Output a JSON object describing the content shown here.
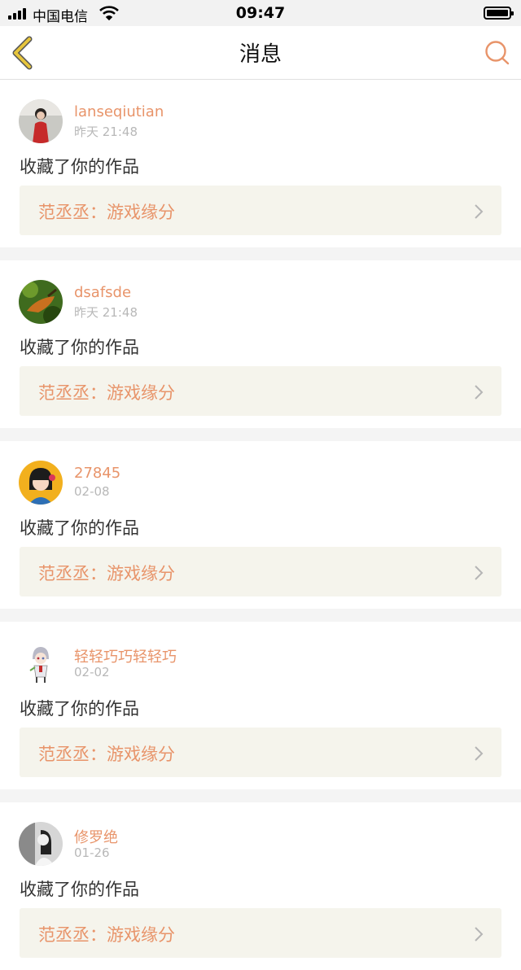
{
  "status_bar": {
    "carrier": "中国电信",
    "time": "09:47",
    "icons": [
      "signal-icon",
      "wifi-icon",
      "battery-icon"
    ]
  },
  "header": {
    "title": "消息",
    "back_icon": "chevron-left-icon",
    "search_icon": "search-icon"
  },
  "colors": {
    "accent": "#e8946a",
    "back_icon": "#e6c53d",
    "card_link_bg": "#f5f4ec",
    "separator": "#f4f4f4"
  },
  "messages": [
    {
      "username": "lanseqiutian",
      "time": "昨天 21:48",
      "action": "收藏了你的作品",
      "work_title": "范丞丞：游戏缘分",
      "avatar": "avatar-girl-red-dress"
    },
    {
      "username": "dsafsde",
      "time": "昨天 21:48",
      "action": "收藏了你的作品",
      "work_title": "范丞丞：游戏缘分",
      "avatar": "avatar-bird-green"
    },
    {
      "username": "27845",
      "time": "02-08",
      "action": "收藏了你的作品",
      "work_title": "范丞丞：游戏缘分",
      "avatar": "avatar-cartoon-girl-yellow"
    },
    {
      "username": "轻轻巧巧轻轻巧",
      "time": "02-02",
      "action": "收藏了你的作品",
      "work_title": "范丞丞：游戏缘分",
      "avatar": "avatar-anime-character"
    },
    {
      "username": "修罗绝",
      "time": "01-26",
      "action": "收藏了你的作品",
      "work_title": "范丞丞：游戏缘分",
      "avatar": "avatar-bw-photo"
    }
  ]
}
